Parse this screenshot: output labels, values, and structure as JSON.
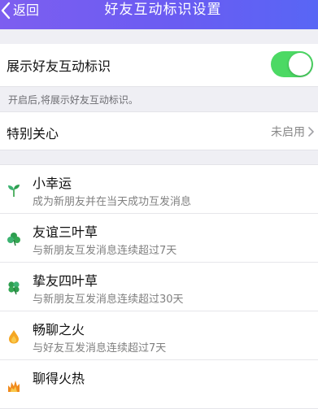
{
  "header": {
    "back_label": "返回",
    "title": "好友互动标识设置",
    "gradient": [
      "#7d5ef0",
      "#5866f5"
    ]
  },
  "settings": {
    "toggle_label": "展示好友互动标识",
    "toggle_on": true,
    "toggle_color": "#4cd964",
    "hint": "开启后,将展示好友互动标识。",
    "special_care_label": "特别关心",
    "special_care_status": "未启用"
  },
  "marks": [
    {
      "name": "小幸运",
      "desc": "成为新朋友并在当天成功互发消息",
      "icon": "sprout-icon"
    },
    {
      "name": "友谊三叶草",
      "desc": "与新朋友互发消息连续超过7天",
      "icon": "three-leaf-clover-icon"
    },
    {
      "name": "挚友四叶草",
      "desc": "与新朋友互发消息连续超过30天",
      "icon": "four-leaf-clover-icon"
    },
    {
      "name": "畅聊之火",
      "desc": "与好友互发消息连续超过7天",
      "icon": "flame-icon"
    },
    {
      "name": "聊得火热",
      "desc": "",
      "icon": "hot-fire-icon"
    }
  ]
}
